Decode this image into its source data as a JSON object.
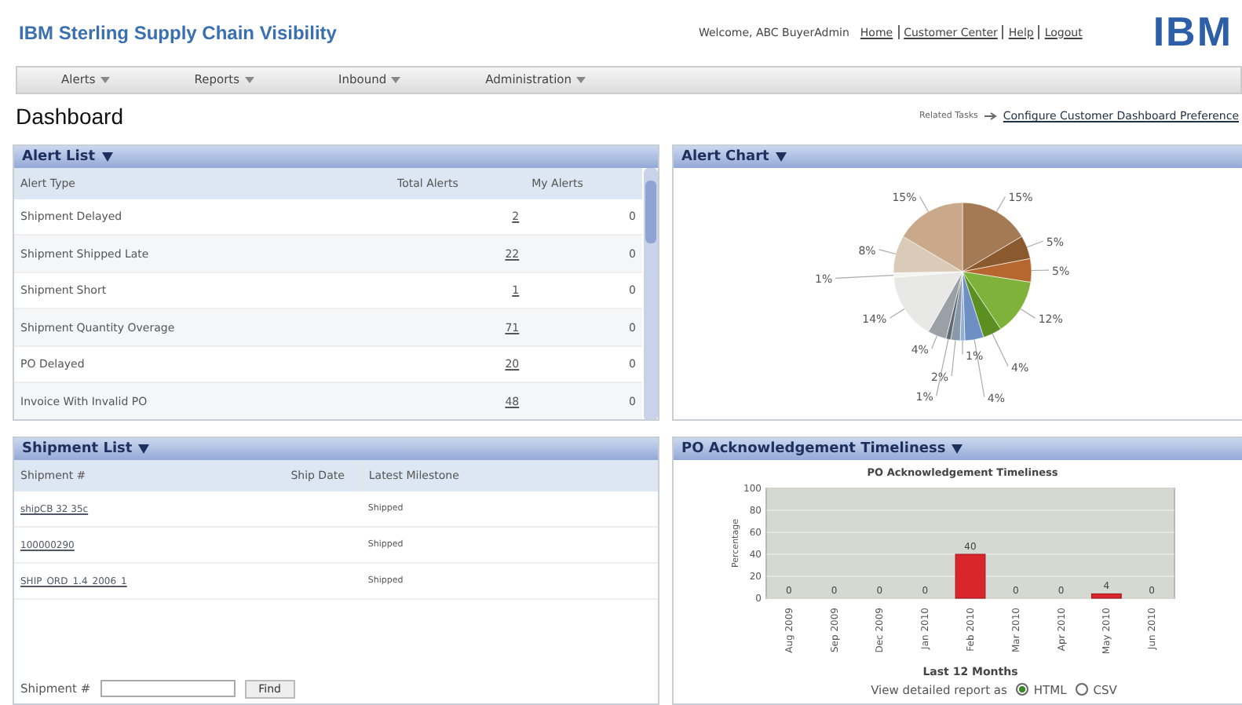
{
  "header": {
    "app_title": "IBM Sterling Supply Chain Visibility",
    "welcome": "Welcome, ABC BuyerAdmin",
    "links": [
      "Home",
      "Customer Center",
      "Help",
      "Logout"
    ],
    "logo": "IBM"
  },
  "menu": [
    "Alerts",
    "Reports",
    "Inbound",
    "Administration"
  ],
  "page": {
    "title": "Dashboard",
    "related_tasks": "Related Tasks",
    "related_link": "Configure Customer Dashboard Preference"
  },
  "alert_list": {
    "title": "Alert List",
    "columns": [
      "Alert Type",
      "Total Alerts",
      "My Alerts"
    ],
    "rows": [
      {
        "type": "Shipment Delayed",
        "total": "2",
        "mine": "0"
      },
      {
        "type": "Shipment Shipped Late",
        "total": "22",
        "mine": "0"
      },
      {
        "type": "Shipment Short",
        "total": "1",
        "mine": "0"
      },
      {
        "type": "Shipment Quantity Overage",
        "total": "71",
        "mine": "0"
      },
      {
        "type": "PO Delayed",
        "total": "20",
        "mine": "0"
      },
      {
        "type": "Invoice With Invalid PO",
        "total": "48",
        "mine": "0"
      }
    ]
  },
  "alert_chart": {
    "title": "Alert Chart",
    "chart_data": {
      "type": "pie",
      "values": [
        15,
        5,
        5,
        12,
        4,
        4,
        1,
        2,
        1,
        4,
        14,
        1,
        8,
        15
      ],
      "value_labels": [
        "15%",
        "5%",
        "5%",
        "12%",
        "4%",
        "4%",
        "1%",
        "2%",
        "1%",
        "4%",
        "14%",
        "1%",
        "8%",
        "15%"
      ]
    }
  },
  "shipment_list": {
    "title": "Shipment List",
    "columns": [
      "Shipment #",
      "Ship Date",
      "Latest Milestone"
    ],
    "rows": [
      {
        "shipment": "shipCB 32 35c",
        "date": "",
        "milestone": "Shipped"
      },
      {
        "shipment": "100000290",
        "date": "",
        "milestone": "Shipped"
      },
      {
        "shipment": "SHIP_ORD_1.4_2006_1",
        "date": "",
        "milestone": "Shipped"
      }
    ],
    "search_label": "Shipment #",
    "search_button": "Find"
  },
  "po_timeliness": {
    "title": "PO Acknowledgement Timeliness",
    "chart_data": {
      "type": "bar",
      "title": "PO Acknowledgement Timeliness",
      "xlabel": "Last 12 Months",
      "ylabel": "Percentage",
      "categories": [
        "Aug 2009",
        "Sep 2009",
        "Dec 2009",
        "Jan 2010",
        "Feb 2010",
        "Mar 2010",
        "Apr 2010",
        "May 2010",
        "Jun 2010"
      ],
      "values": [
        0,
        0,
        0,
        0,
        40,
        0,
        0,
        4,
        0
      ],
      "ylim": [
        0,
        100
      ],
      "yticks": [
        0,
        20,
        40,
        60,
        80,
        100
      ],
      "grid": true,
      "data_labels": true
    },
    "report_label": "View detailed report as",
    "formats": [
      {
        "label": "HTML",
        "selected": true
      },
      {
        "label": "CSV",
        "selected": false
      }
    ]
  }
}
